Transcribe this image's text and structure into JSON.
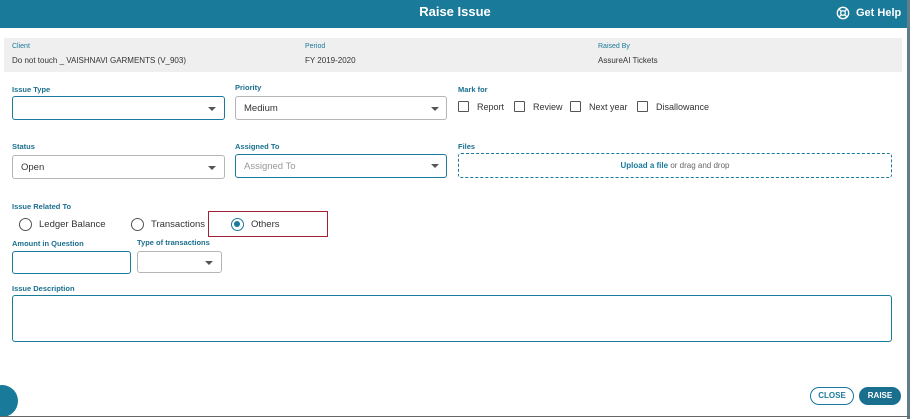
{
  "header": {
    "title": "Raise Issue",
    "help_label": "Get Help"
  },
  "info": {
    "client_label": "Client",
    "client_value": "Do not touch _ VAISHNAVI GARMENTS (V_903)",
    "period_label": "Period",
    "period_value": "FY 2019-2020",
    "raised_by_label": "Raised By",
    "raised_by_value": "AssureAI Tickets"
  },
  "form": {
    "issue_type_label": "Issue Type",
    "issue_type_value": "",
    "priority_label": "Priority",
    "priority_value": "Medium",
    "mark_for_label": "Mark for",
    "mark_for_options": [
      "Report",
      "Review",
      "Next year",
      "Disallowance"
    ],
    "status_label": "Status",
    "status_value": "Open",
    "assigned_to_label": "Assigned To",
    "assigned_to_placeholder": "Assigned To",
    "files_label": "Files",
    "files_upload_link": "Upload a file",
    "files_drop_text": "or drag and drop",
    "issue_related_label": "Issue Related To",
    "issue_related_options": [
      "Ledger Balance",
      "Transactions",
      "Others"
    ],
    "issue_related_selected": "Others",
    "amount_label": "Amount in Question",
    "amount_value": "",
    "type_of_transactions_label": "Type of transactions",
    "type_of_transactions_value": "",
    "description_label": "Issue Description",
    "description_value": ""
  },
  "footer": {
    "close_label": "CLOSE",
    "raise_label": "RAISE"
  },
  "colors": {
    "primary": "#1a7a9a",
    "highlight_border": "#9b2335"
  },
  "icons": {
    "help": "lifebuoy-icon",
    "dropdown": "chevron-down-icon"
  }
}
